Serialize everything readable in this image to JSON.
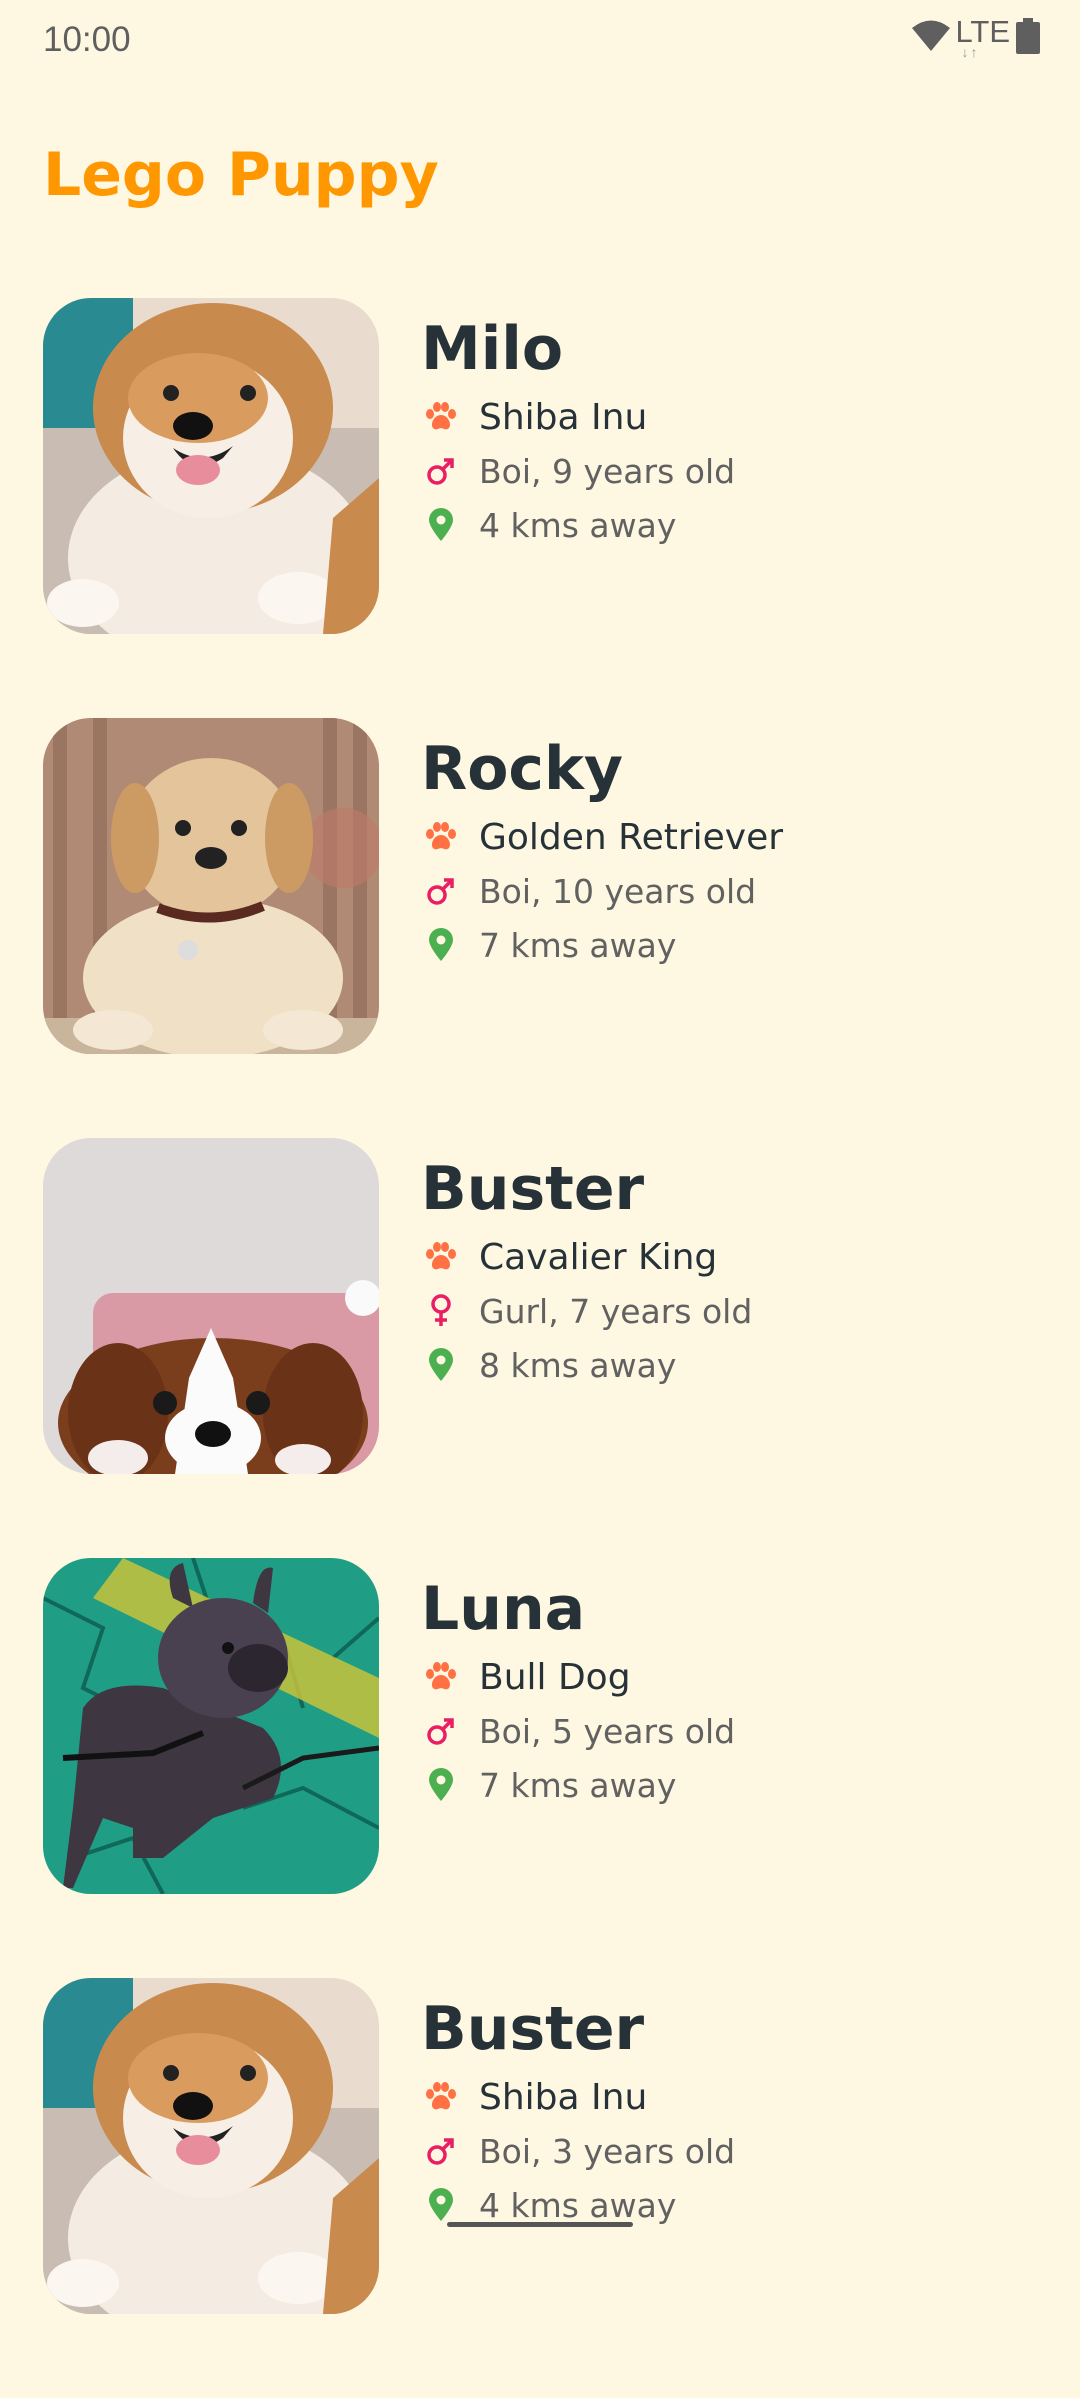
{
  "status_bar": {
    "time": "10:00",
    "network": "LTE"
  },
  "app": {
    "title": "Lego Puppy"
  },
  "colors": {
    "accent": "#FF9800",
    "background": "#FEF7E2",
    "paw": "#FF7043",
    "gender": "#E91E63",
    "location": "#4CAF50"
  },
  "pets": [
    {
      "name": "Milo",
      "breed": "Shiba Inu",
      "gender_icon": "male-icon",
      "info": "Boi, 9 years old",
      "distance": "4 kms away",
      "photo": "shiba"
    },
    {
      "name": "Rocky",
      "breed": "Golden Retriever",
      "gender_icon": "male-icon",
      "info": "Boi, 10 years old",
      "distance": "7 kms away",
      "photo": "golden"
    },
    {
      "name": "Buster",
      "breed": "Cavalier King",
      "gender_icon": "female-icon",
      "info": "Gurl, 7 years old",
      "distance": "8 kms away",
      "photo": "cavalier"
    },
    {
      "name": "Luna",
      "breed": "Bull Dog",
      "gender_icon": "male-icon",
      "info": "Boi, 5 years old",
      "distance": "7 kms away",
      "photo": "bulldog"
    },
    {
      "name": "Buster",
      "breed": "Shiba Inu",
      "gender_icon": "male-icon",
      "info": "Boi, 3 years old",
      "distance": "4 kms away",
      "photo": "shiba"
    }
  ]
}
